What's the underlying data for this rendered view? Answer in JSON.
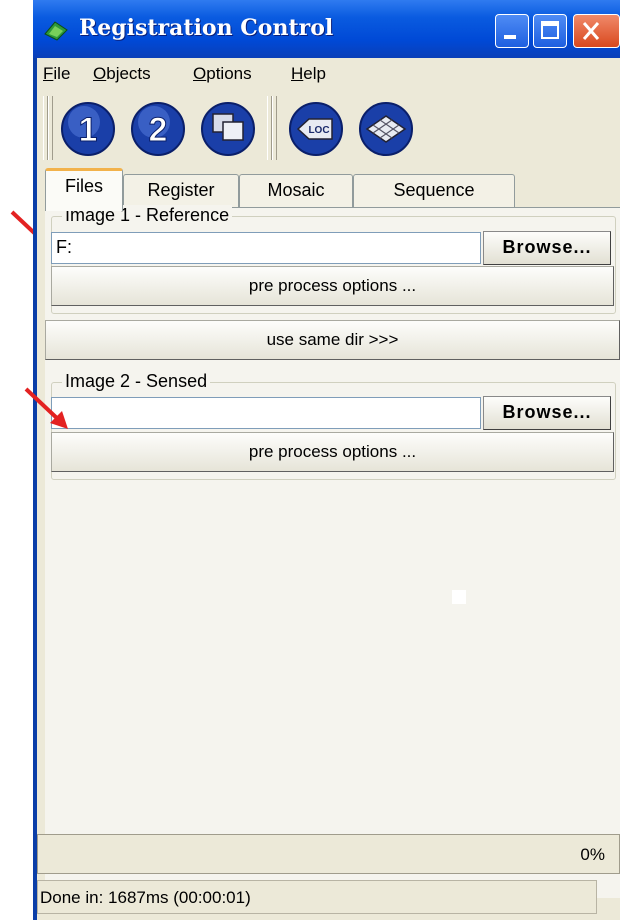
{
  "window": {
    "title": "Registration Control",
    "controls": {
      "minimize": "minimize-icon",
      "maximize": "maximize-icon",
      "close": "close-icon"
    }
  },
  "menu": [
    {
      "label": "File",
      "mnemonic": "F",
      "rest": "ile"
    },
    {
      "label": "Objects",
      "mnemonic": "O",
      "rest": "bjects"
    },
    {
      "label": "Options",
      "mnemonic": "O",
      "rest": "ptions"
    },
    {
      "label": "Help",
      "mnemonic": "H",
      "rest": "elp"
    }
  ],
  "toolbar": {
    "buttons": [
      {
        "icon": "number-1-icon",
        "glyph": "1"
      },
      {
        "icon": "number-2-icon",
        "glyph": "2"
      },
      {
        "icon": "overlay-windows-icon",
        "glyph": ""
      },
      {
        "icon": "loc-icon",
        "glyph": "LOC"
      },
      {
        "icon": "grid-mosaic-icon",
        "glyph": ""
      }
    ]
  },
  "tabs": [
    {
      "label": "Files",
      "active": true
    },
    {
      "label": "Register",
      "active": false
    },
    {
      "label": "Mosaic",
      "active": false
    },
    {
      "label": "Sequence",
      "active": false
    }
  ],
  "image1": {
    "legend": "Image 1 - Reference",
    "path_value": "F:",
    "browse_label": "Browse...",
    "preprocess_label": "pre process options ..."
  },
  "same_dir_label": "use same dir >>>",
  "image2": {
    "legend": "Image 2 - Sensed",
    "path_value": "",
    "browse_label": "Browse...",
    "preprocess_label": "pre process options ..."
  },
  "status": {
    "progress_text": "0%",
    "progress_value": 0,
    "done_text": "Done in: 1687ms (00:00:01)"
  },
  "annotation_color": "#e32222"
}
